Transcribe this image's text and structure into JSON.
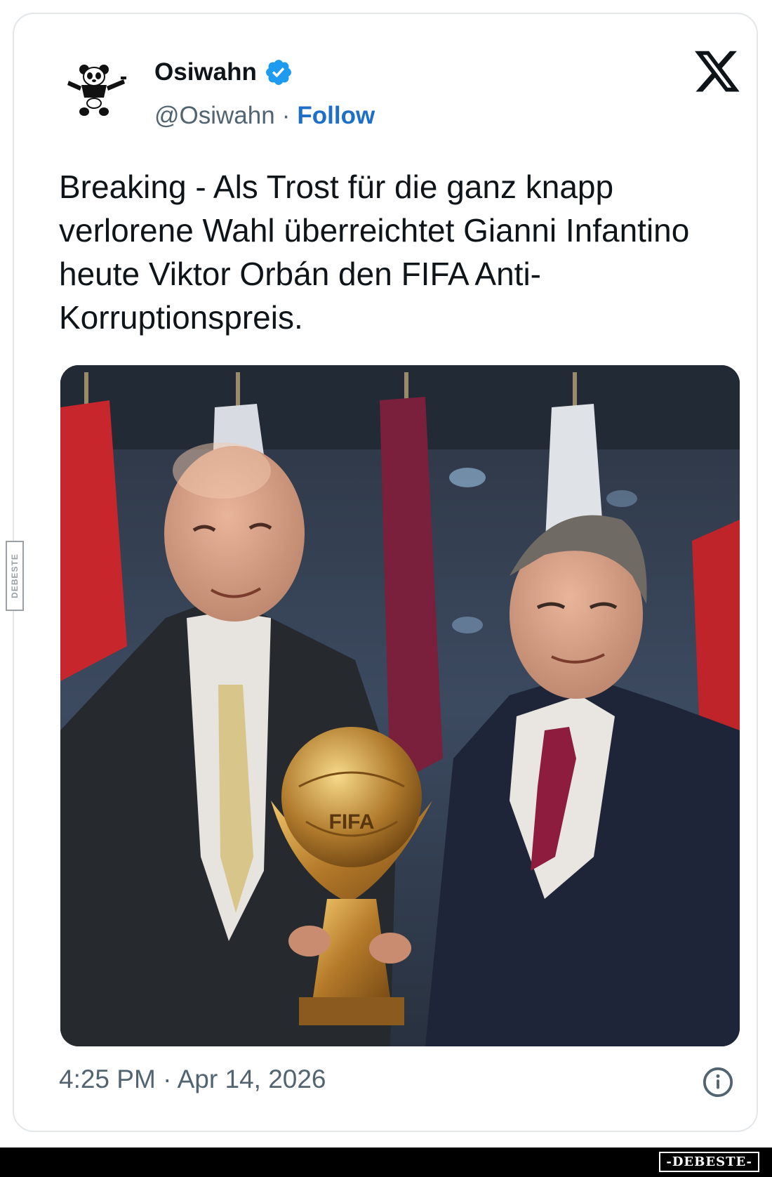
{
  "tweet": {
    "author_name": "Osiwahn",
    "handle": "@Osiwahn",
    "separator": "·",
    "follow_label": "Follow",
    "verified": true,
    "text": "Breaking - Als Trost für die ganz knapp verlorene Wahl überreichtet Gianni Infantino heute Viktor Orbán den FIFA Anti-Korruptionspreis.",
    "timestamp": "4:25 PM · Apr 14, 2026",
    "media": {
      "trophy_text": "FIFA"
    }
  },
  "icons": {
    "avatar": "panda-avatar-icon",
    "verified": "verified-badge-icon",
    "platform_logo": "x-logo-icon",
    "info": "info-icon"
  },
  "watermarks": {
    "side": "DEBESTE",
    "bottom": "-DEBESTE-"
  },
  "colors": {
    "follow_link": "#1d6fc7",
    "verified_badge": "#1d9bf0",
    "text_primary": "#0f1419",
    "text_secondary": "#536471",
    "card_border": "#e3e7ea"
  }
}
